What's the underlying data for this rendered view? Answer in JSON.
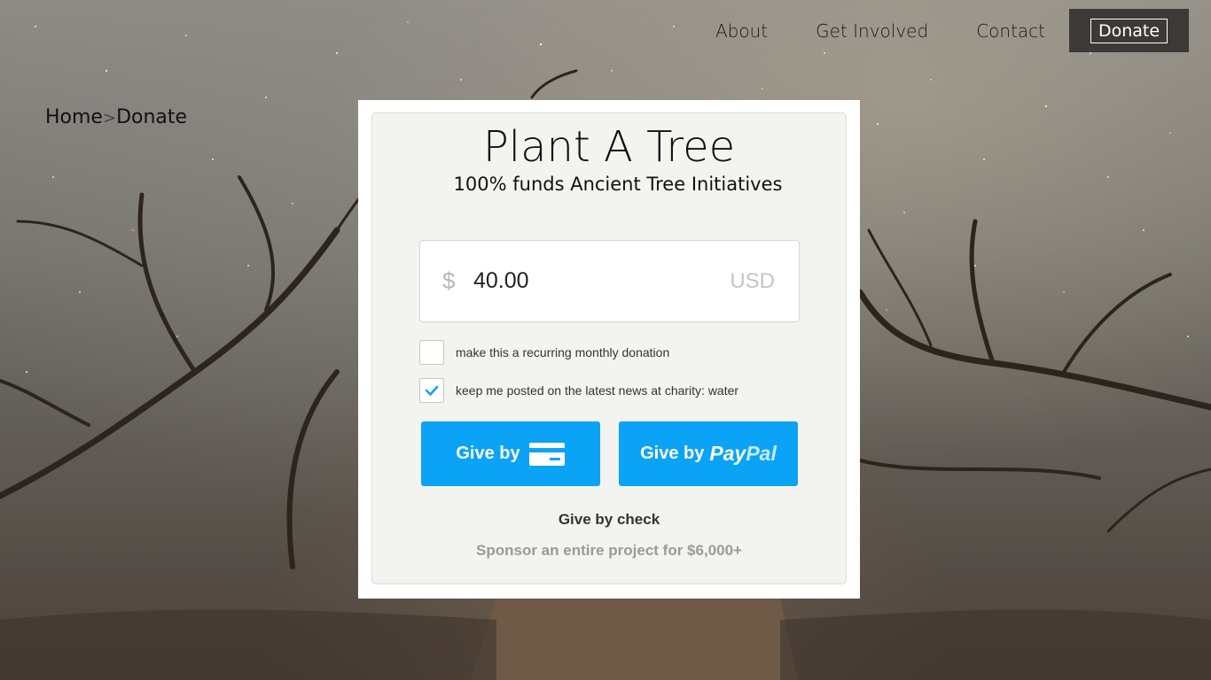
{
  "nav": {
    "links": [
      "About",
      "Get Involved",
      "Contact"
    ],
    "donate_label": "Donate"
  },
  "breadcrumb": {
    "home": "Home",
    "separator": ">",
    "current": "Donate"
  },
  "card": {
    "title": "Plant A Tree",
    "subtitle": "100% funds Ancient Tree Initiatives",
    "amount": {
      "symbol": "$",
      "value": "40.00",
      "currency": "USD"
    },
    "recurring": {
      "label": "make this a recurring monthly donation",
      "checked": false
    },
    "newsletter": {
      "label": "keep me posted on the latest news at charity: water",
      "checked": true
    },
    "give_card_label": "Give by",
    "give_paypal_label": "Give by",
    "paypal_pay": "Pay",
    "paypal_pal": "Pal",
    "give_check_label": "Give by check",
    "sponsor_label": "Sponsor an entire project for $6,000+"
  },
  "colors": {
    "accent": "#0ba3f5",
    "nav_donate_bg": "#3c3a37",
    "card_bg": "#f3f3ef"
  },
  "icons": [
    "credit-card-icon",
    "checkmark-icon"
  ]
}
